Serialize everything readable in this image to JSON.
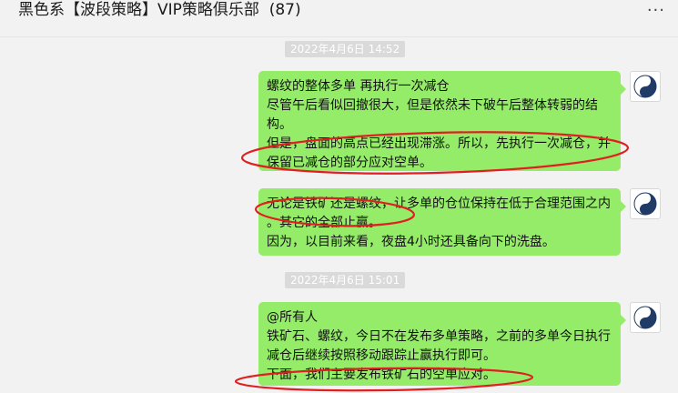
{
  "header": {
    "title": "黑色系【波段策略】VIP策略俱乐部",
    "member_count": "(87)",
    "more_icon": "more-dots-icon",
    "more_label": "···"
  },
  "messages": [
    {
      "timestamp": "2022年4月6日 14:52",
      "lines": [
        "螺纹的整体多单 再执行一次减仓",
        " 尽管午后看似回撤很大，但是依然未下破午后整体转弱的结",
        "构。",
        "但是，盘面的高点已经出现滞涨。所以，先执行一次减仓，并",
        "保留已减仓的部分应对空单。"
      ],
      "avatar_icon": "yin-yang-icon"
    },
    {
      "lines": [
        "无论是铁矿还是螺纹，让多单的仓位保持在低于合理范围之内",
        "。其它的全部止赢。",
        "因为，以目前来看，夜盘4小时还具备向下的洗盘。"
      ],
      "avatar_icon": "yin-yang-icon"
    },
    {
      "timestamp": "2022年4月6日 15:01",
      "lines": [
        "@所有人",
        "铁矿石、螺纹，今日不在发布多单策略，之前的多单今日执行",
        "减仓后继续按照移动跟踪止赢执行即可。",
        "下面，我们主要发布铁矿石的空单应对。"
      ],
      "avatar_icon": "yin-yang-icon"
    }
  ],
  "colors": {
    "bubble": "#95ec69",
    "annotation": "#e02020",
    "timestamp_bg": "#dadada",
    "background": "#f2f2f2"
  }
}
